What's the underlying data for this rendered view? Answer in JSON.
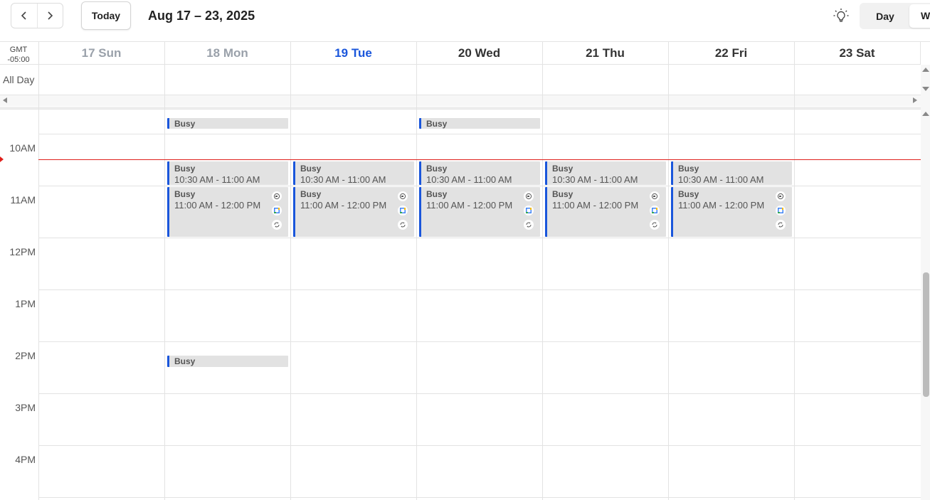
{
  "toolbar": {
    "prev_icon": "chevron-left-icon",
    "next_icon": "chevron-right-icon",
    "today_label": "Today",
    "range_title": "Aug 17 – 23, 2025",
    "theme_icon": "lightbulb-icon",
    "views": {
      "day": "Day",
      "week": "W"
    }
  },
  "header": {
    "timezone": [
      "GMT",
      "-05:00"
    ],
    "days": [
      {
        "label": "17 Sun",
        "state": "past"
      },
      {
        "label": "18 Mon",
        "state": "past"
      },
      {
        "label": "19 Tue",
        "state": "today"
      },
      {
        "label": "20 Wed",
        "state": "future"
      },
      {
        "label": "21 Thu",
        "state": "future"
      },
      {
        "label": "22 Fri",
        "state": "future"
      },
      {
        "label": "23 Sat",
        "state": "future"
      }
    ],
    "all_day_label": "All Day"
  },
  "grid": {
    "hours": [
      "10AM",
      "11AM",
      "12PM",
      "1PM",
      "2PM",
      "3PM",
      "4PM"
    ],
    "current_time_indicator": true
  },
  "events": [
    {
      "day": 1,
      "title": "Busy",
      "time": "",
      "start": "09:40",
      "end": "09:55",
      "icons": false
    },
    {
      "day": 3,
      "title": "Busy",
      "time": "",
      "start": "09:40",
      "end": "09:55",
      "icons": false
    },
    {
      "day": 1,
      "title": "Busy",
      "time": "10:30 AM - 11:00 AM",
      "start": "10:30",
      "end": "11:00",
      "icons": false
    },
    {
      "day": 2,
      "title": "Busy",
      "time": "10:30 AM - 11:00 AM",
      "start": "10:30",
      "end": "11:00",
      "icons": false
    },
    {
      "day": 3,
      "title": "Busy",
      "time": "10:30 AM - 11:00 AM",
      "start": "10:30",
      "end": "11:00",
      "icons": false
    },
    {
      "day": 4,
      "title": "Busy",
      "time": "10:30 AM - 11:00 AM",
      "start": "10:30",
      "end": "11:00",
      "icons": false
    },
    {
      "day": 5,
      "title": "Busy",
      "time": "10:30 AM - 11:00 AM",
      "start": "10:30",
      "end": "11:00",
      "icons": false
    },
    {
      "day": 1,
      "title": "Busy",
      "time": "11:00 AM - 12:00 PM",
      "start": "11:00",
      "end": "12:00",
      "icons": true
    },
    {
      "day": 2,
      "title": "Busy",
      "time": "11:00 AM - 12:00 PM",
      "start": "11:00",
      "end": "12:00",
      "icons": true
    },
    {
      "day": 3,
      "title": "Busy",
      "time": "11:00 AM - 12:00 PM",
      "start": "11:00",
      "end": "12:00",
      "icons": true
    },
    {
      "day": 4,
      "title": "Busy",
      "time": "11:00 AM - 12:00 PM",
      "start": "11:00",
      "end": "12:00",
      "icons": true
    },
    {
      "day": 5,
      "title": "Busy",
      "time": "11:00 AM - 12:00 PM",
      "start": "11:00",
      "end": "12:00",
      "icons": true
    },
    {
      "day": 1,
      "title": "Busy",
      "time": "",
      "start": "14:15",
      "end": "14:30",
      "icons": false
    }
  ],
  "event_icons": [
    "zoom-icon",
    "google-calendar-icon",
    "recurring-icon"
  ],
  "colors": {
    "accent": "#1a56db",
    "now_line": "#e0201b",
    "event_bg": "#e2e2e2",
    "past_day": "#9aa1aa",
    "today_day": "#1a56db",
    "future_day": "#333333"
  }
}
